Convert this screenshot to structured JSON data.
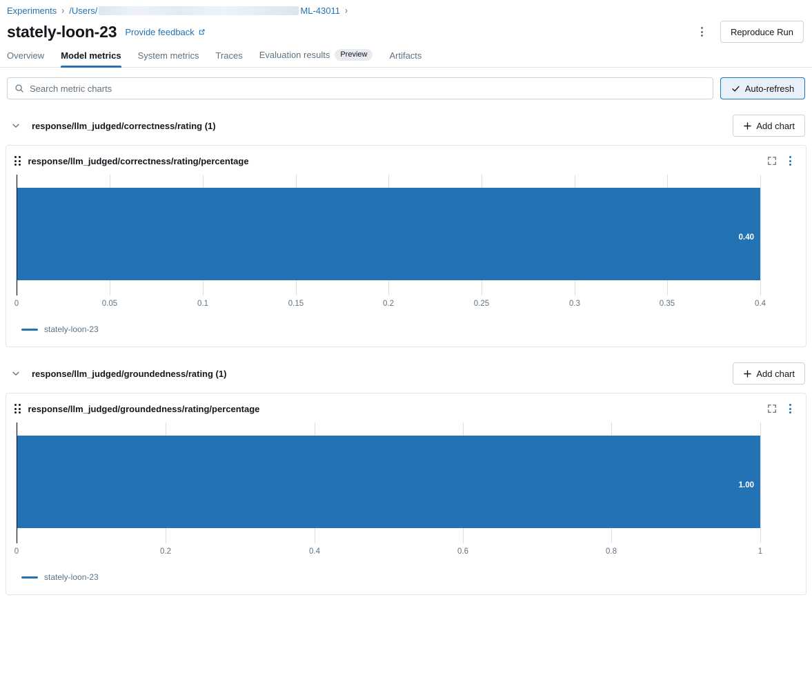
{
  "breadcrumb": {
    "items": [
      {
        "label": "Experiments",
        "type": "link"
      },
      {
        "label": "/Users/",
        "type": "link"
      },
      {
        "label": "",
        "type": "redacted"
      },
      {
        "label": "ML-43011",
        "type": "link"
      }
    ],
    "separator": "›"
  },
  "header": {
    "title": "stately-loon-23",
    "feedback_label": "Provide feedback",
    "external_link_icon": "external-link-icon",
    "overflow_icon": "vertical-dots-icon",
    "reproduce_label": "Reproduce Run"
  },
  "tabs": [
    {
      "label": "Overview",
      "active": false
    },
    {
      "label": "Model metrics",
      "active": true
    },
    {
      "label": "System metrics",
      "active": false
    },
    {
      "label": "Traces",
      "active": false
    },
    {
      "label": "Evaluation results",
      "active": false,
      "badge": "Preview"
    },
    {
      "label": "Artifacts",
      "active": false
    }
  ],
  "toolbar": {
    "search_placeholder": "Search metric charts",
    "search_value": "",
    "search_icon": "search-icon",
    "auto_refresh_label": "Auto-refresh",
    "auto_refresh_checked": true,
    "check_icon": "check-icon"
  },
  "groups": [
    {
      "title": "response/llm_judged/correctness/rating (1)",
      "add_chart_label": "Add chart",
      "expanded": true,
      "chart": {
        "title": "response/llm_judged/correctness/rating/percentage",
        "expand_icon": "fullscreen-icon",
        "menu_icon": "vertical-dots-icon",
        "legend": "stately-loon-23"
      }
    },
    {
      "title": "response/llm_judged/groundedness/rating (1)",
      "add_chart_label": "Add chart",
      "expanded": true,
      "chart": {
        "title": "response/llm_judged/groundedness/rating/percentage",
        "expand_icon": "fullscreen-icon",
        "menu_icon": "vertical-dots-icon",
        "legend": "stately-loon-23"
      }
    }
  ],
  "colors": {
    "bar": "#2272b4",
    "accent": "#2272b4",
    "grid": "#d6dee6",
    "axis": "#11171c",
    "tick_text": "#5f7281"
  },
  "chart_data": [
    {
      "type": "bar",
      "orientation": "horizontal",
      "title": "response/llm_judged/correctness/rating/percentage",
      "categories": [
        "stately-loon-23"
      ],
      "values": [
        0.4
      ],
      "data_labels": [
        "0.40"
      ],
      "xlabel": "",
      "ylabel": "",
      "xlim": [
        0,
        0.4
      ],
      "xticks": [
        0,
        0.05,
        0.1,
        0.15,
        0.2,
        0.25,
        0.3,
        0.35,
        0.4
      ],
      "xticklabels": [
        "0",
        "0.05",
        "0.1",
        "0.15",
        "0.2",
        "0.25",
        "0.3",
        "0.35",
        "0.4"
      ],
      "grid": true,
      "legend": [
        "stately-loon-23"
      ],
      "legend_position": "bottom-left",
      "series_color": "#2272b4"
    },
    {
      "type": "bar",
      "orientation": "horizontal",
      "title": "response/llm_judged/groundedness/rating/percentage",
      "categories": [
        "stately-loon-23"
      ],
      "values": [
        1.0
      ],
      "data_labels": [
        "1.00"
      ],
      "xlabel": "",
      "ylabel": "",
      "xlim": [
        0,
        1
      ],
      "xticks": [
        0,
        0.2,
        0.4,
        0.6,
        0.8,
        1
      ],
      "xticklabels": [
        "0",
        "0.2",
        "0.4",
        "0.6",
        "0.8",
        "1"
      ],
      "grid": true,
      "legend": [
        "stately-loon-23"
      ],
      "legend_position": "bottom-left",
      "series_color": "#2272b4"
    }
  ]
}
